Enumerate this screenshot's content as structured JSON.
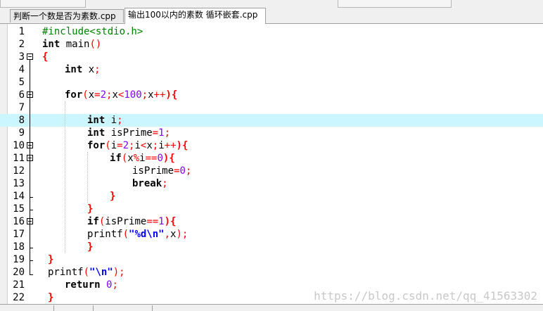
{
  "tabs": [
    {
      "label": "判断一个数是否为素数.cpp",
      "active": false
    },
    {
      "label": "输出100以内的素数 循环嵌套.cpp",
      "active": true
    }
  ],
  "editor": {
    "highlighted_line": 8,
    "lines": [
      {
        "n": "1"
      },
      {
        "n": "2"
      },
      {
        "n": "3"
      },
      {
        "n": "4"
      },
      {
        "n": "5"
      },
      {
        "n": "6"
      },
      {
        "n": "7"
      },
      {
        "n": "8"
      },
      {
        "n": "9"
      },
      {
        "n": "10"
      },
      {
        "n": "11"
      },
      {
        "n": "12"
      },
      {
        "n": "13"
      },
      {
        "n": "14"
      },
      {
        "n": "15"
      },
      {
        "n": "16"
      },
      {
        "n": "17"
      },
      {
        "n": "18"
      },
      {
        "n": "19"
      },
      {
        "n": "20"
      },
      {
        "n": "21"
      },
      {
        "n": "22"
      }
    ],
    "code": {
      "l1_pp": "#include<stdio.h>",
      "l2_kw": "int",
      "l2_rest": " main",
      "l2_p": "()",
      "l3_b": "{",
      "l4_kw": "int",
      "l4_rest": " x",
      "l4_semi": ";",
      "l6_kw": "for",
      "l6_p1": "(",
      "l6_a": "x",
      "l6_eq": "=",
      "l6_n1": "2",
      "l6_s1": ";",
      "l6_b": "x",
      "l6_lt": "<",
      "l6_n2": "100",
      "l6_s2": ";",
      "l6_c": "x",
      "l6_inc": "++",
      "l6_p2": "){",
      "l8_kw": "int",
      "l8_rest": " i",
      "l8_semi": ";",
      "l9_kw": "int",
      "l9_rest": " isPrime",
      "l9_eq": "=",
      "l9_n": "1",
      "l9_semi": ";",
      "l10_kw": "for",
      "l10_p1": "(",
      "l10_a": "i",
      "l10_eq": "=",
      "l10_n": "2",
      "l10_s1": ";",
      "l10_b": "i",
      "l10_lt": "<",
      "l10_c": "x",
      "l10_s2": ";",
      "l10_d": "i",
      "l10_inc": "++",
      "l10_p2": "){",
      "l11_kw": "if",
      "l11_p1": "(",
      "l11_a": "x",
      "l11_mod": "%",
      "l11_b": "i",
      "l11_eq": "==",
      "l11_n": "0",
      "l11_p2": "){",
      "l12_a": "isPrime",
      "l12_eq": "=",
      "l12_n": "0",
      "l12_semi": ";",
      "l13_kw": "break",
      "l13_semi": ";",
      "l14_b": "}",
      "l15_b": "}",
      "l16_kw": "if",
      "l16_p1": "(",
      "l16_a": "isPrime",
      "l16_eq": "==",
      "l16_n": "1",
      "l16_p2": "){",
      "l17_a": "printf",
      "l17_p1": "(",
      "l17_str": "\"%d\\n\"",
      "l17_comma": ",",
      "l17_x": "x",
      "l17_p2": ");",
      "l18_b": "}",
      "l19_b": "}",
      "l20_a": "printf",
      "l20_p1": "(",
      "l20_str": "\"\\n\"",
      "l20_p2": ");",
      "l21_kw": "return",
      "l21_n": " 0",
      "l21_semi": ";",
      "l22_b": "}"
    }
  },
  "watermark": "https://blog.csdn.net/qq_41563302"
}
